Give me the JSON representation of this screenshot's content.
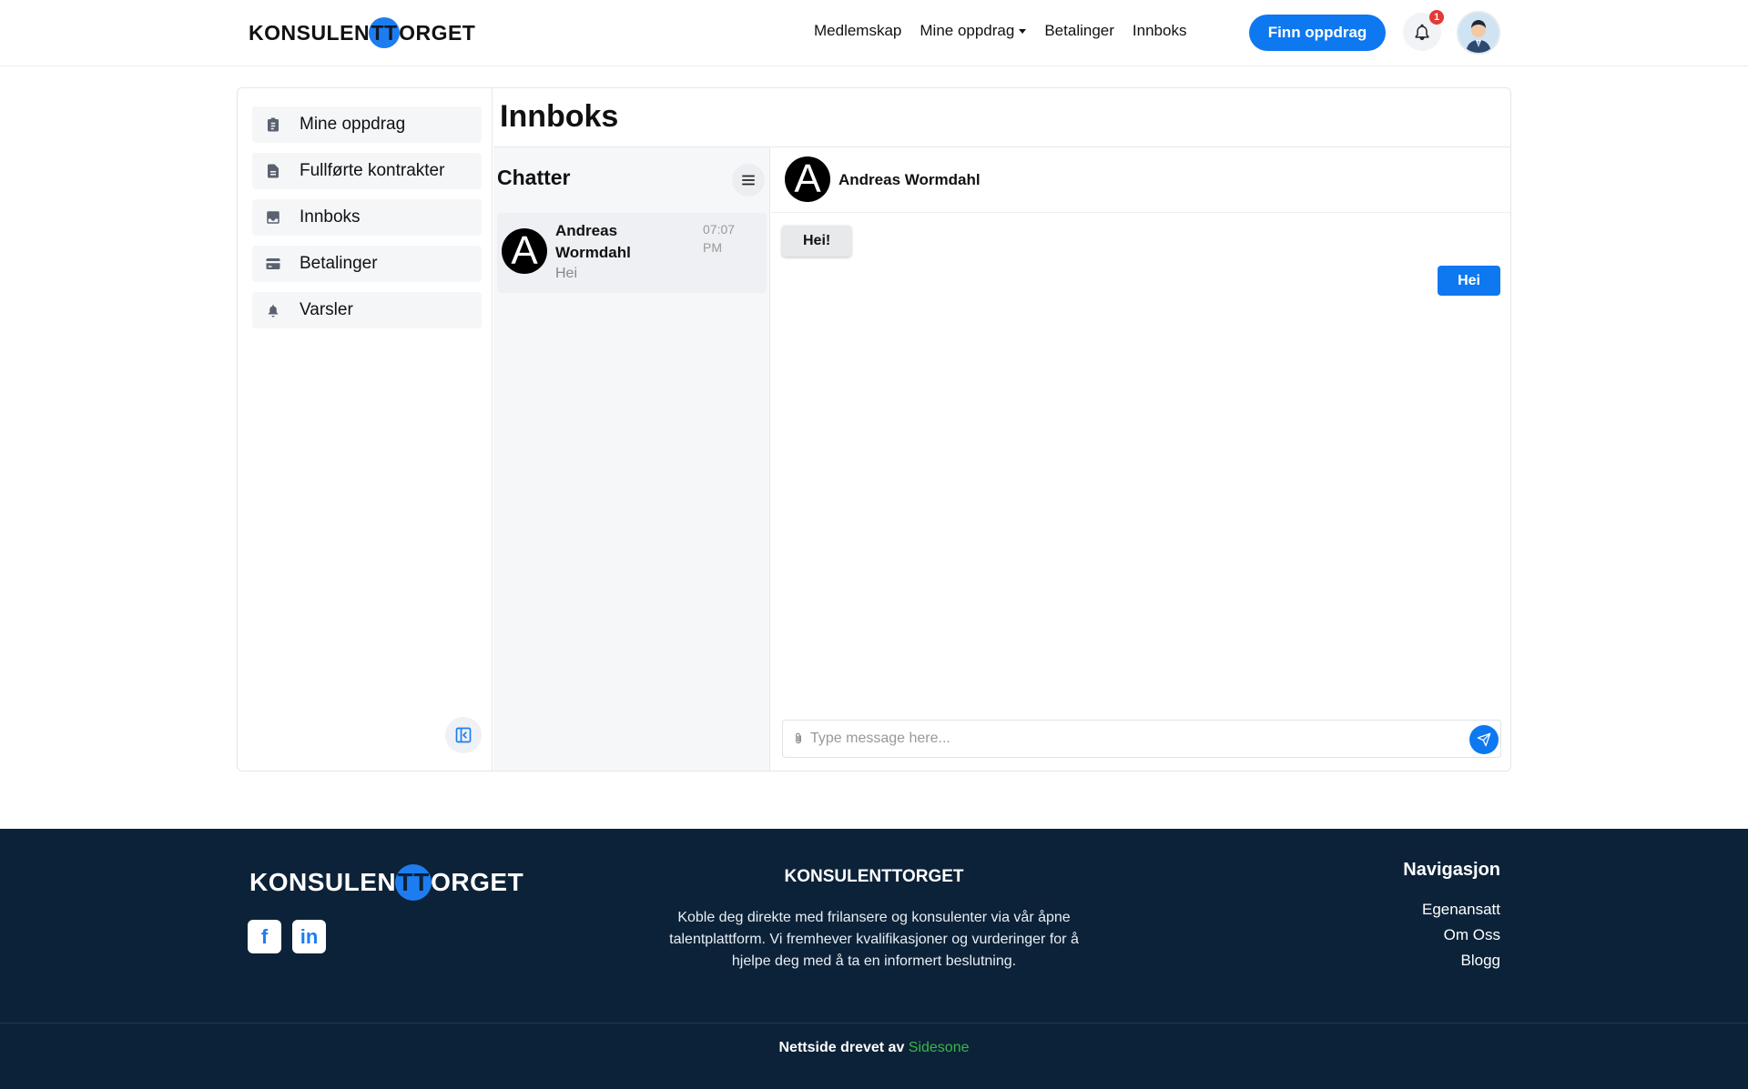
{
  "header": {
    "logo_pre": "KONSULEN",
    "logo_tt": "TT",
    "logo_post": "ORGET",
    "nav": [
      "Medlemskap",
      "Mine oppdrag",
      "Betalinger",
      "Innboks"
    ],
    "cta": "Finn oppdrag",
    "notification_count": "1"
  },
  "sidebar": {
    "items": [
      {
        "label": "Mine oppdrag",
        "icon": "clipboard-icon"
      },
      {
        "label": "Fullførte kontrakter",
        "icon": "document-icon"
      },
      {
        "label": "Innboks",
        "icon": "inbox-icon"
      },
      {
        "label": "Betalinger",
        "icon": "credit-card-icon"
      },
      {
        "label": "Varsler",
        "icon": "bell-icon"
      }
    ]
  },
  "inbox": {
    "title": "Innboks",
    "chats_title": "Chatter",
    "chats": [
      {
        "initial": "A",
        "name": "Andreas Wormdahl",
        "preview": "Hei",
        "time": "07:07 PM"
      }
    ]
  },
  "conversation": {
    "initial": "A",
    "name": "Andreas Wormdahl",
    "messages": [
      {
        "direction": "in",
        "text": "Hei!"
      },
      {
        "direction": "out",
        "text": "Hei"
      }
    ],
    "input_placeholder": "Type message here..."
  },
  "footer": {
    "logo_pre": "KONSULEN",
    "logo_tt": "TT",
    "logo_post": "ORGET",
    "social": [
      "f",
      "in"
    ],
    "about_title": "KONSULENTTORGET",
    "about_text": "Koble deg direkte med frilansere og konsulenter via vår åpne talentplattform. Vi fremhever kvalifikasjoner og vurderinger for å hjelpe deg med å ta en informert beslutning.",
    "nav_title": "Navigasjon",
    "nav_links": [
      "Egenansatt",
      "Om Oss",
      "Blogg"
    ],
    "credit_prefix": "Nettside drevet av ",
    "credit_brand": "Sidesone"
  },
  "colors": {
    "accent": "#0d78f0",
    "footer_bg": "#0c2238",
    "badge": "#e53935",
    "credit_brand": "#3bb54a"
  }
}
